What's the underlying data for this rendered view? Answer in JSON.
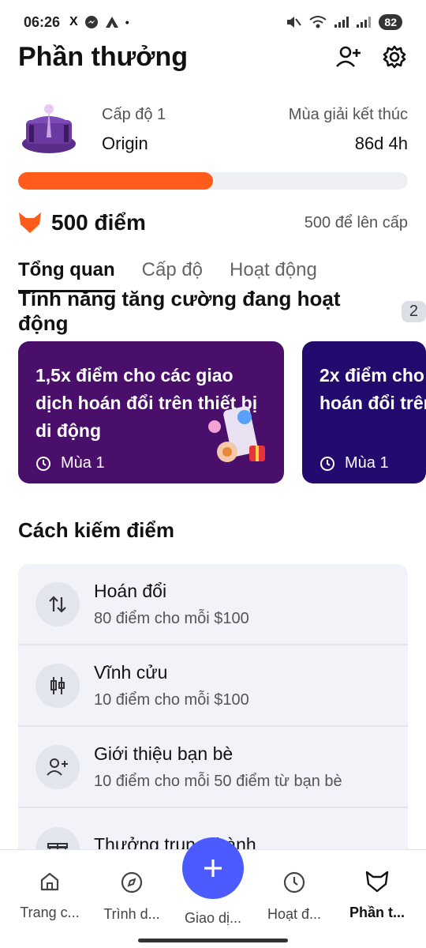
{
  "status": {
    "time": "06:26",
    "notif_icons": [
      "X",
      "messenger",
      "A",
      "•"
    ],
    "battery": "82"
  },
  "header": {
    "title": "Phần thưởng"
  },
  "level": {
    "level_label": "Cấp độ 1",
    "level_name": "Origin",
    "season_label": "Mùa giải kết thúc",
    "season_remaining": "86d 4h",
    "progress_fraction": 0.5
  },
  "points": {
    "value": "500 điểm",
    "to_next_level": "500 để lên cấp"
  },
  "tabs": [
    {
      "label": "Tổng quan",
      "active": true
    },
    {
      "label": "Cấp độ",
      "active": false
    },
    {
      "label": "Hoạt động",
      "active": false
    }
  ],
  "boosts": {
    "title": "Tính năng tăng cường đang hoạt động",
    "count": "2",
    "cards": [
      {
        "text": "1,5x điểm cho các giao dịch hoán đổi trên thiết bị di động",
        "season": "Mùa 1",
        "color": "#4a0f6b"
      },
      {
        "text": "2x điểm cho hoán đổi trên",
        "season": "Mùa 1",
        "color": "#230a6e"
      }
    ]
  },
  "earn": {
    "title": "Cách kiếm điểm",
    "items": [
      {
        "title": "Hoán đổi",
        "subtitle": "80 điểm cho mỗi $100",
        "icon": "swap-arrows-icon"
      },
      {
        "title": "Vĩnh cửu",
        "subtitle": "10 điểm cho mỗi $100",
        "icon": "candlestick-icon"
      },
      {
        "title": "Giới thiệu bạn bè",
        "subtitle": "10 điểm cho mỗi 50 điểm từ bạn bè",
        "icon": "add-user-icon"
      },
      {
        "title": "Thưởng trung thành",
        "subtitle": "",
        "icon": "gift-icon"
      }
    ]
  },
  "nav": [
    {
      "label": "Trang c...",
      "icon": "home-icon"
    },
    {
      "label": "Trình d...",
      "icon": "compass-icon"
    },
    {
      "label": "Giao dị...",
      "icon": "plus-icon"
    },
    {
      "label": "Hoạt đ...",
      "icon": "clock-icon"
    },
    {
      "label": "Phần t...",
      "icon": "fox-icon",
      "active": true
    }
  ],
  "colors": {
    "accent_orange": "#ff5b1a",
    "primary_blue": "#4c5bff"
  }
}
